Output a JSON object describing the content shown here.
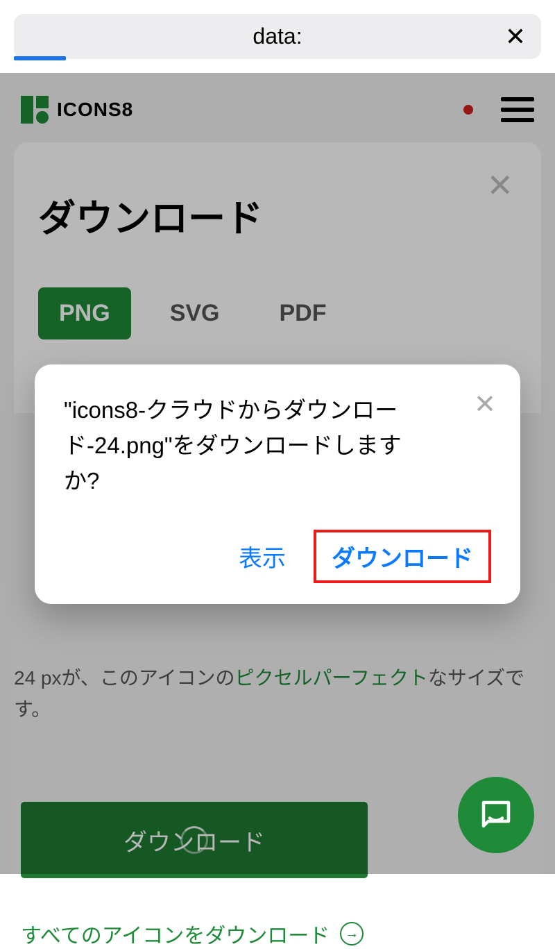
{
  "browser": {
    "url_label": "data:",
    "close_glyph": "✕"
  },
  "header": {
    "brand": "ICONS8"
  },
  "modal": {
    "title": "ダウンロード",
    "tabs": [
      "PNG",
      "SVG",
      "PDF"
    ],
    "hint_prefix": "24 pxが、このアイコンの",
    "hint_link": "ピクセルパーフェクト",
    "hint_suffix": "なサイズです。",
    "download_button": "ダウンロード",
    "all_download": "すべてのアイコンをダウンロード"
  },
  "confirm": {
    "message": "\"icons8-クラウドからダウンロード-24.png\"をダウンロードしますか?",
    "view": "表示",
    "download": "ダウンロード"
  }
}
